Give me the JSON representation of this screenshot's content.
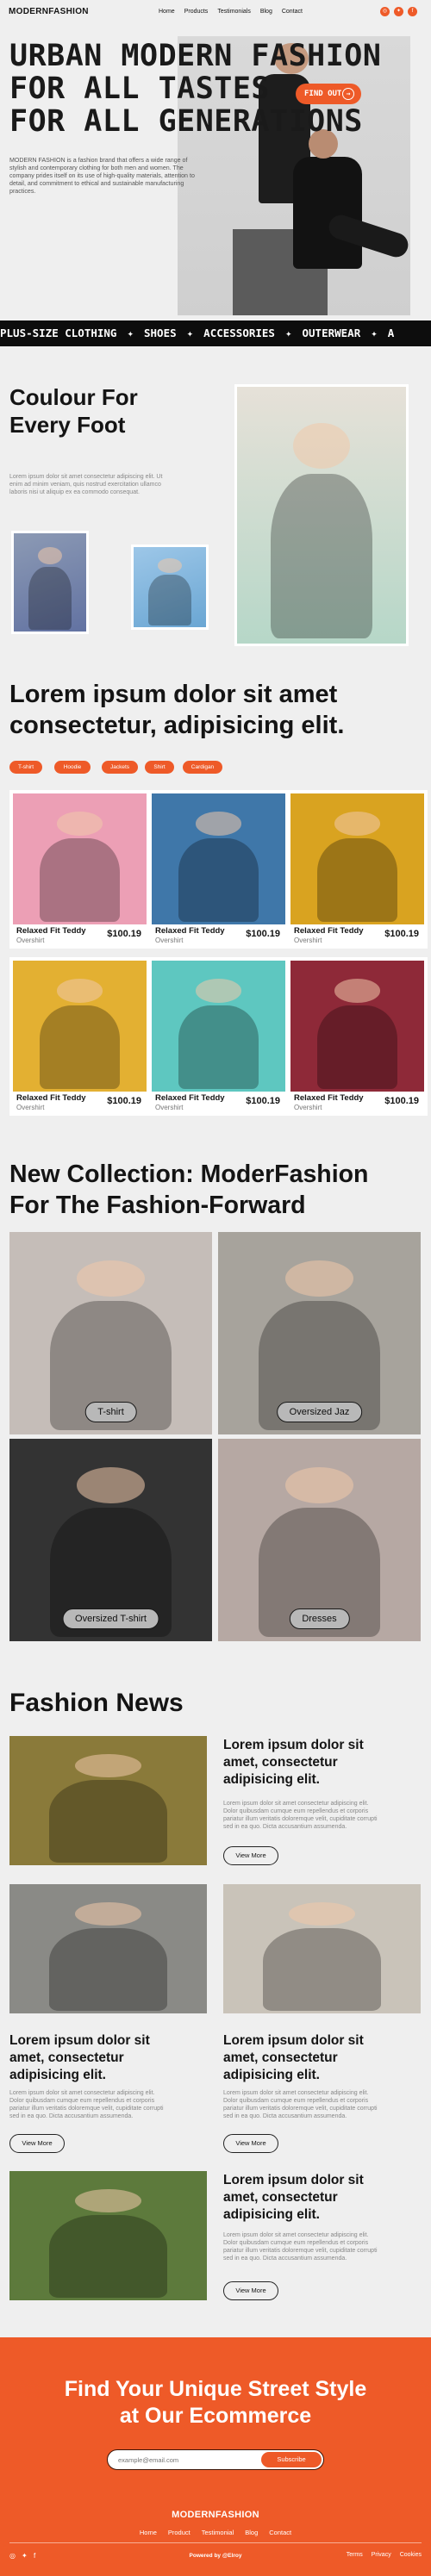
{
  "brand": "MODERNFASHION",
  "nav": [
    "Home",
    "Products",
    "Testimonials",
    "Blog",
    "Contact"
  ],
  "social": [
    "IG",
    "TW",
    "FB"
  ],
  "hero": {
    "lines": [
      "URBAN MODERN FASHION",
      "FOR ALL TASTES",
      "FOR ALL GENERATIONS"
    ],
    "cta": "FIND OUT",
    "cta_icon": "arrow-right-icon",
    "paragraph": "MODERN FASHION is a fashion brand that offers a wide range of stylish and contemporary clothing for both men and women. The company prides itself on its use of high-quality materials, attention to detail, and commitment to ethical and sustainable manufacturing practices."
  },
  "marquee": [
    "PLUS-SIZE CLOTHING",
    "SHOES",
    "ACCESSORIES",
    "OUTERWEAR",
    "A"
  ],
  "colour": {
    "title_1": "Coulour For",
    "title_2": "Every Foot",
    "text": "Lorem ipsum dolor sit amet consectetur adipiscing elit. Ut enim ad minim veniam, quis nostrud exercitation ullamco laboris nisi ut aliquip ex ea commodo consequat."
  },
  "products": {
    "title_1": "Lorem ipsum dolor sit amet",
    "title_2": "consectetur, adipisicing elit.",
    "chips": [
      "T-shirt",
      "Hoodie",
      "Jackets",
      "Shirt",
      "Cardigan"
    ],
    "items": [
      {
        "name": "Relaxed Fit Teddy",
        "sub": "Overshirt",
        "price": "$100.19",
        "bg": "#ec9fb5"
      },
      {
        "name": "Relaxed Fit Teddy",
        "sub": "Overshirt",
        "price": "$100.19",
        "bg": "#3f77a9"
      },
      {
        "name": "Relaxed Fit Teddy",
        "sub": "Overshirt",
        "price": "$100.19",
        "bg": "#d9a320"
      },
      {
        "name": "Relaxed Fit Teddy",
        "sub": "Overshirt",
        "price": "$100.19",
        "bg": "#e3b032"
      },
      {
        "name": "Relaxed Fit Teddy",
        "sub": "Overshirt",
        "price": "$100.19",
        "bg": "#5ec7c0"
      },
      {
        "name": "Relaxed Fit Teddy",
        "sub": "Overshirt",
        "price": "$100.19",
        "bg": "#8e2938"
      }
    ]
  },
  "collection": {
    "title_1": "New Collection: ModerFashion",
    "title_2": "For The Fashion-Forward",
    "items": [
      {
        "label": "T-shirt",
        "bg": "#c5bdb8"
      },
      {
        "label": "Oversized Jaz",
        "bg": "#a7a39c"
      },
      {
        "label": "Oversized T-shirt",
        "bg": "#333333"
      },
      {
        "label": "Dresses",
        "bg": "#b6a8a3"
      }
    ]
  },
  "news": {
    "title": "Fashion News",
    "heading": [
      "Lorem ipsum dolor sit",
      "amet, consectetur",
      "adipisicing elit."
    ],
    "body": "Lorem ipsum dolor sit amet consectetur adipiscing elit. Dolor quibusdam cumque eum repellendus et corporis pariatur illum veritatis doloremque velit, cupiditate corrupti sed in ea quo. Dicta accusantium assumenda.",
    "view_more": "View More"
  },
  "footer": {
    "cta_1": "Find Your Unique Street Style",
    "cta_2": "at Our Ecommerce",
    "email_placeholder": "example@email.com",
    "subscribe": "Subscribe",
    "brand": "MODERNFASHION",
    "nav": [
      "Home",
      "Product",
      "Testimonial",
      "Blog",
      "Contact"
    ],
    "powered": "Powered by @Elroy",
    "legal": [
      "Terms",
      "Privacy",
      "Cookies"
    ],
    "accent": "#ee5a28"
  }
}
